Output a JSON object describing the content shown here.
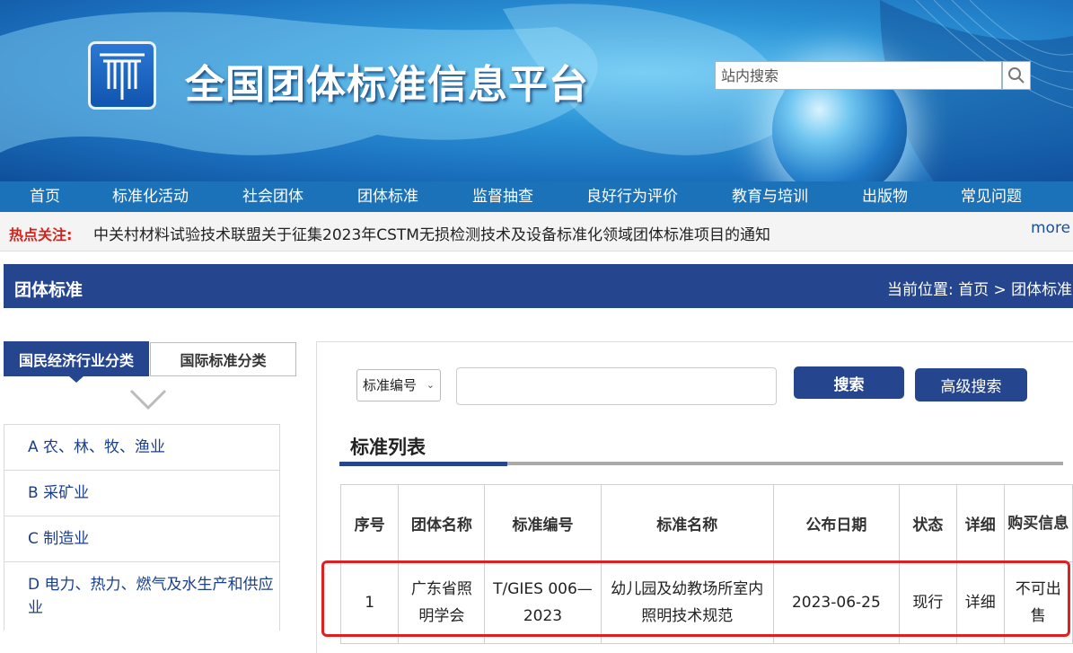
{
  "header": {
    "site_title": "全国团体标准信息平台",
    "search_placeholder": "站内搜索"
  },
  "nav": [
    {
      "label": "首页"
    },
    {
      "label": "标准化活动"
    },
    {
      "label": "社会团体"
    },
    {
      "label": "团体标准"
    },
    {
      "label": "监督抽查"
    },
    {
      "label": "良好行为评价"
    },
    {
      "label": "教育与培训"
    },
    {
      "label": "出版物"
    },
    {
      "label": "常见问题"
    }
  ],
  "hot": {
    "label": "热点关注:",
    "text": "中关村材料试验技术联盟关于征集2023年CSTM无损检测技术及设备标准化领域团体标准项目的通知",
    "more": "more"
  },
  "section": {
    "title": "团体标准",
    "breadcrumb": "当前位置: 首页 > 团体标准"
  },
  "sidebar": {
    "tabs": [
      "国民经济行业分类",
      "国际标准分类"
    ],
    "categories": [
      "A 农、林、牧、渔业",
      "B 采矿业",
      "C 制造业",
      "D 电力、热力、燃气及水生产和供应业"
    ]
  },
  "search": {
    "select_value": "标准编号",
    "search_button": "搜索",
    "advanced_button": "高级搜索"
  },
  "list": {
    "title": "标准列表",
    "headers": [
      "序号",
      "团体名称",
      "标准编号",
      "标准名称",
      "公布日期",
      "状态",
      "详细",
      "购买信息"
    ],
    "rows": [
      [
        "1",
        "广东省照明学会",
        "T/GIES 006—2023",
        "幼儿园及幼教场所室内照明技术规范",
        "2023-06-25",
        "现行",
        "详细",
        "不可出售"
      ]
    ]
  },
  "colors": {
    "nav_bg": "#1b72b8",
    "primary": "#25458e",
    "hot_label": "#d6221b",
    "highlight": "#e02020"
  }
}
